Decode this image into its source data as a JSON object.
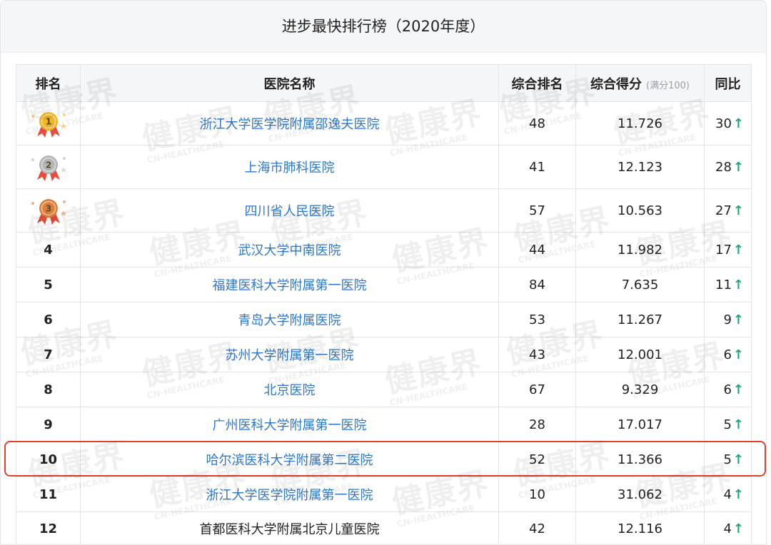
{
  "panel": {
    "title": "进步最快排行榜（2020年度）"
  },
  "table": {
    "headers": {
      "rank": "排名",
      "name": "医院名称",
      "overall_rank": "综合排名",
      "score": "综合得分",
      "score_note": "(满分100)",
      "yoy": "同比"
    },
    "rows": [
      {
        "rank": "1",
        "medal": "gold",
        "name": "浙江大学医学院附属邵逸夫医院",
        "overall_rank": "48",
        "score": "11.726",
        "yoy": "30",
        "trend": "up"
      },
      {
        "rank": "2",
        "medal": "silver",
        "name": "上海市肺科医院",
        "overall_rank": "41",
        "score": "12.123",
        "yoy": "28",
        "trend": "up"
      },
      {
        "rank": "3",
        "medal": "bronze",
        "name": "四川省人民医院",
        "overall_rank": "57",
        "score": "10.563",
        "yoy": "27",
        "trend": "up"
      },
      {
        "rank": "4",
        "name": "武汉大学中南医院",
        "overall_rank": "44",
        "score": "11.982",
        "yoy": "17",
        "trend": "up"
      },
      {
        "rank": "5",
        "name": "福建医科大学附属第一医院",
        "overall_rank": "84",
        "score": "7.635",
        "yoy": "11",
        "trend": "up"
      },
      {
        "rank": "6",
        "name": "青岛大学附属医院",
        "overall_rank": "53",
        "score": "11.267",
        "yoy": "9",
        "trend": "up"
      },
      {
        "rank": "7",
        "name": "苏州大学附属第一医院",
        "overall_rank": "43",
        "score": "12.001",
        "yoy": "6",
        "trend": "up"
      },
      {
        "rank": "8",
        "name": "北京医院",
        "overall_rank": "67",
        "score": "9.329",
        "yoy": "6",
        "trend": "up"
      },
      {
        "rank": "9",
        "name": "广州医科大学附属第一医院",
        "overall_rank": "28",
        "score": "17.017",
        "yoy": "5",
        "trend": "up"
      },
      {
        "rank": "10",
        "name": "哈尔滨医科大学附属第二医院",
        "overall_rank": "52",
        "score": "11.366",
        "yoy": "5",
        "trend": "up",
        "highlighted": true
      },
      {
        "rank": "11",
        "name": "浙江大学医学院附属第一医院",
        "overall_rank": "10",
        "score": "31.062",
        "yoy": "4",
        "trend": "up"
      },
      {
        "rank": "12",
        "name": "首都医科大学附属北京儿童医院",
        "overall_rank": "42",
        "score": "12.116",
        "yoy": "4",
        "trend": "up",
        "linked": false
      }
    ]
  },
  "watermark": {
    "main": "健康界",
    "sub": "CN-HEALTHCARE"
  },
  "icons": {
    "medal": "medal-icon",
    "trend": "arrow-up-icon"
  },
  "colors": {
    "link": "#2d77cf",
    "trend_up": "#19a86b",
    "highlight_border": "#e0412f",
    "gold": "#f2b629",
    "silver": "#b5b5b5",
    "bronze": "#e07f3c",
    "ribbon": "#e74c3c"
  }
}
